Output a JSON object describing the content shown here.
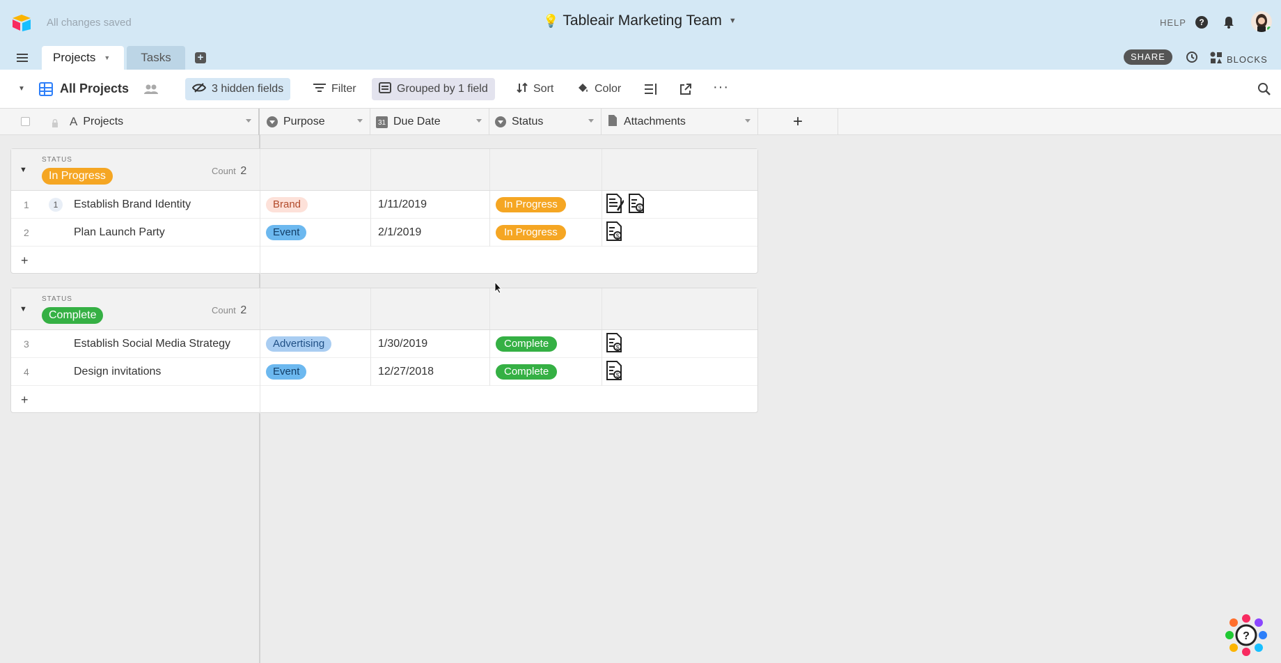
{
  "header": {
    "save_status": "All changes saved",
    "base_title": "Tableair Marketing Team",
    "help_label": "HELP"
  },
  "tabs": [
    {
      "label": "Projects",
      "active": true
    },
    {
      "label": "Tasks",
      "active": false
    }
  ],
  "tab_actions": {
    "share_label": "SHARE",
    "blocks_label": "BLOCKS"
  },
  "toolbar": {
    "view_name": "All Projects",
    "hidden_fields": "3 hidden fields",
    "filter": "Filter",
    "grouped": "Grouped by 1 field",
    "sort": "Sort",
    "color": "Color"
  },
  "columns": [
    "Projects",
    "Purpose",
    "Due Date",
    "Status",
    "Attachments"
  ],
  "groups": [
    {
      "field_label": "STATUS",
      "value": "In Progress",
      "count_label": "Count",
      "count": "2",
      "rows": [
        {
          "num": "1",
          "comment": "1",
          "project": "Establish Brand Identity",
          "purpose": "Brand",
          "due": "1/11/2019",
          "status": "In Progress",
          "attachments": 2
        },
        {
          "num": "2",
          "comment": "",
          "project": "Plan Launch Party",
          "purpose": "Event",
          "due": "2/1/2019",
          "status": "In Progress",
          "attachments": 1
        }
      ]
    },
    {
      "field_label": "STATUS",
      "value": "Complete",
      "count_label": "Count",
      "count": "2",
      "rows": [
        {
          "num": "3",
          "comment": "",
          "project": "Establish Social Media Strategy",
          "purpose": "Advertising",
          "due": "1/30/2019",
          "status": "Complete",
          "attachments": 1
        },
        {
          "num": "4",
          "comment": "",
          "project": "Design invitations",
          "purpose": "Event",
          "due": "12/27/2018",
          "status": "Complete",
          "attachments": 1
        }
      ]
    }
  ],
  "colors": {
    "header_bg": "#d4e8f5",
    "in_progress": "#f5a623",
    "complete": "#35b044",
    "brand_pill": "#fde1d9",
    "event_pill": "#6cb8ef",
    "advertising_pill": "#a9cdf2"
  },
  "icons": [
    "airtable-logo-icon",
    "menu-icon",
    "add-table-icon",
    "grid-view-icon",
    "people-icon",
    "hidden-fields-icon",
    "filter-icon",
    "group-icon",
    "sort-icon",
    "color-icon",
    "row-height-icon",
    "share-view-icon",
    "more-icon",
    "search-icon",
    "help-icon",
    "bell-icon",
    "avatar",
    "history-icon",
    "blocks-icon",
    "document-icon",
    "lock-icon",
    "help-widget-icon"
  ]
}
